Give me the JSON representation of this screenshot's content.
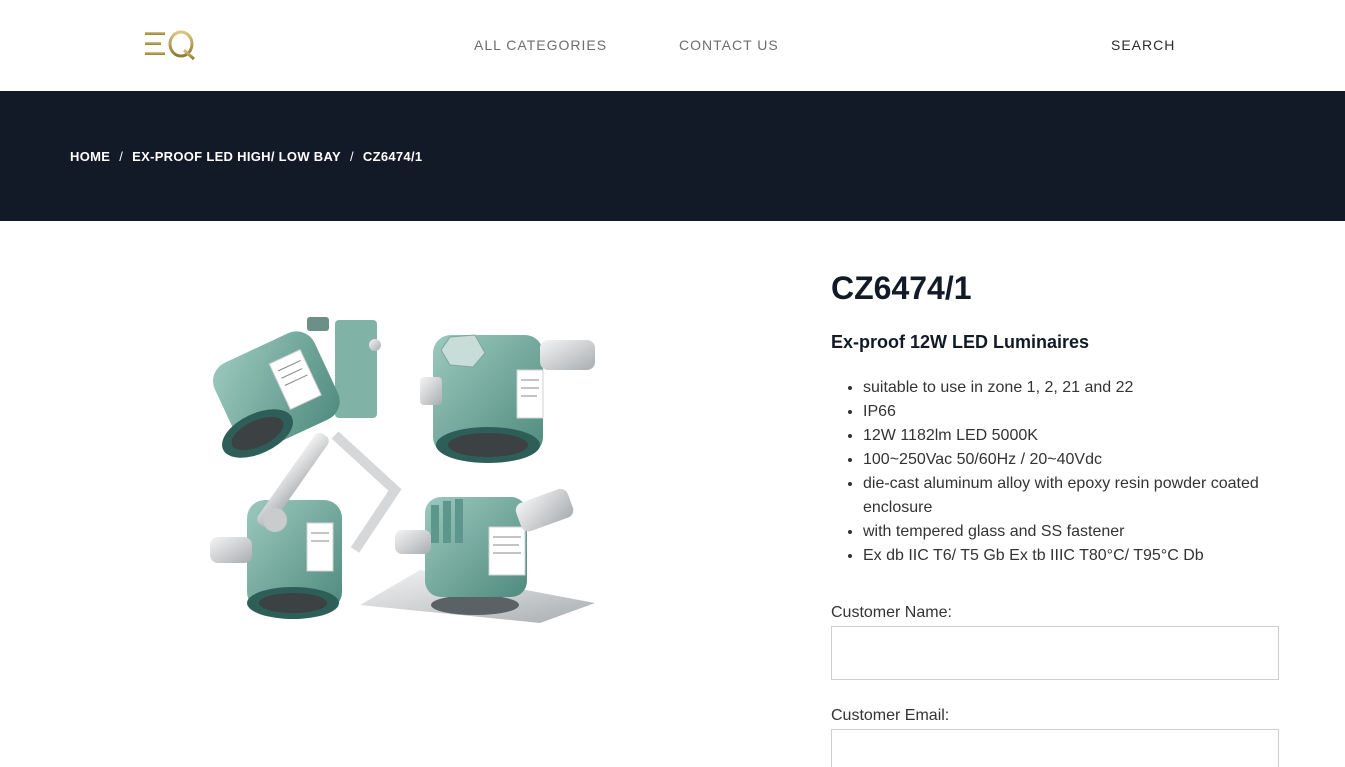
{
  "header": {
    "logo_text": "EQ",
    "nav": {
      "all_categories": "ALL CATEGORIES",
      "contact_us": "CONTACT US",
      "search": "SEARCH"
    }
  },
  "breadcrumb": {
    "home": "HOME",
    "category": "EX-PROOF LED HIGH/ LOW BAY",
    "current": "CZ6474/1",
    "separator": "/"
  },
  "product": {
    "title": "CZ6474/1",
    "subtitle": "Ex-proof 12W LED Luminaires",
    "image_alt": "four explosion-proof LED luminaire variants",
    "features": [
      "suitable to use in zone 1, 2, 21 and 22",
      "IP66",
      "12W 1182lm LED 5000K",
      "100~250Vac 50/60Hz / 20~40Vdc",
      "die-cast aluminum alloy with epoxy resin powder coated enclosure",
      "with tempered glass and SS fastener",
      "Ex db IIC T6/ T5 Gb Ex tb IIIC T80°C/ T95°C Db"
    ]
  },
  "form": {
    "customer_name_label": "Customer Name:",
    "customer_name_value": "",
    "customer_email_label": "Customer Email:",
    "customer_email_value": ""
  },
  "colors": {
    "banner_bg": "#131a27",
    "logo_gold": "#b9a55a",
    "housing_teal": "#6fa79b"
  }
}
